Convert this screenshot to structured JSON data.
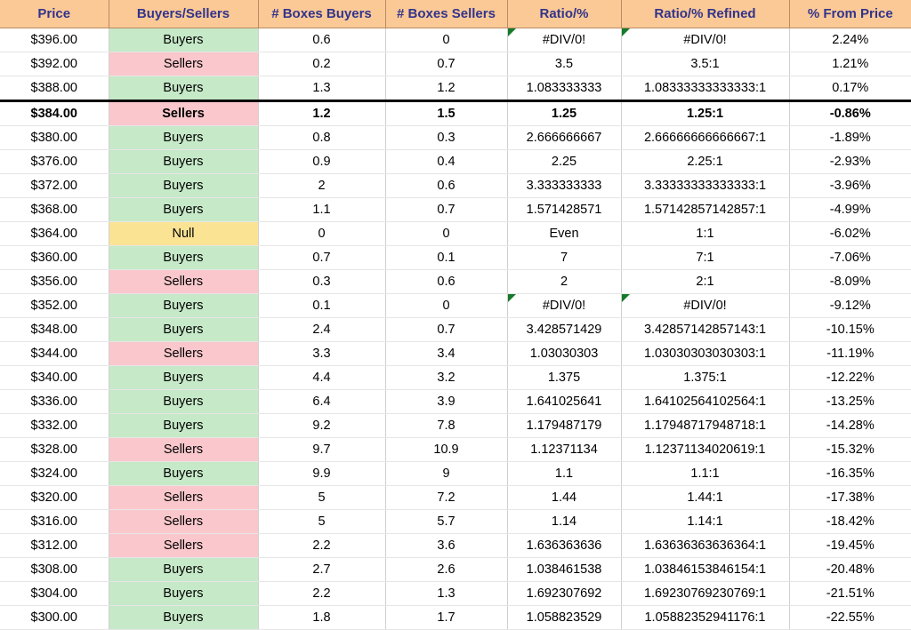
{
  "table": {
    "columns": [
      {
        "key": "price",
        "label": "Price"
      },
      {
        "key": "side",
        "label": "Buyers/Sellers"
      },
      {
        "key": "boxes_buy",
        "label": "# Boxes Buyers"
      },
      {
        "key": "boxes_sell",
        "label": "# Boxes Sellers"
      },
      {
        "key": "ratio",
        "label": "Ratio/%"
      },
      {
        "key": "ratio_ref",
        "label": "Ratio/% Refined"
      },
      {
        "key": "pct",
        "label": "% From Price"
      }
    ],
    "colors": {
      "header_bg": "#FBC996",
      "header_text": "#32348C",
      "buyers_bg": "#C6E9C8",
      "buyers_text": "#1F7A1F",
      "sellers_bg": "#FAC7CC",
      "sellers_text": "#D81633",
      "null_bg": "#FBE394",
      "null_text": "#D98A18",
      "error_marker": "#167A2B",
      "focus_border": "#000000"
    },
    "rows": [
      {
        "price": "$396.00",
        "side": "Buyers",
        "side_fill": "buyers",
        "boxes_buy": "0.6",
        "boxes_sell": "0",
        "ratio": "#DIV/0!",
        "ratio_error": true,
        "ratio_ref": "#DIV/0!",
        "ratio_ref_error": true,
        "pct": "2.24%",
        "focus": false
      },
      {
        "price": "$392.00",
        "side": "Sellers",
        "side_fill": "sellers",
        "boxes_buy": "0.2",
        "boxes_sell": "0.7",
        "ratio": "3.5",
        "ratio_error": false,
        "ratio_ref": "3.5:1",
        "ratio_ref_error": false,
        "pct": "1.21%",
        "focus": false
      },
      {
        "price": "$388.00",
        "side": "Buyers",
        "side_fill": "buyers",
        "boxes_buy": "1.3",
        "boxes_sell": "1.2",
        "ratio": "1.083333333",
        "ratio_error": false,
        "ratio_ref": "1.08333333333333:1",
        "ratio_ref_error": false,
        "pct": "0.17%",
        "focus": false
      },
      {
        "price": "$384.00",
        "side": "Sellers",
        "side_fill": "sellers",
        "boxes_buy": "1.2",
        "boxes_sell": "1.5",
        "ratio": "1.25",
        "ratio_error": false,
        "ratio_ref": "1.25:1",
        "ratio_ref_error": false,
        "pct": "-0.86%",
        "focus": true
      },
      {
        "price": "$380.00",
        "side": "Buyers",
        "side_fill": "buyers",
        "boxes_buy": "0.8",
        "boxes_sell": "0.3",
        "ratio": "2.666666667",
        "ratio_error": false,
        "ratio_ref": "2.66666666666667:1",
        "ratio_ref_error": false,
        "pct": "-1.89%",
        "focus": false
      },
      {
        "price": "$376.00",
        "side": "Buyers",
        "side_fill": "buyers",
        "boxes_buy": "0.9",
        "boxes_sell": "0.4",
        "ratio": "2.25",
        "ratio_error": false,
        "ratio_ref": "2.25:1",
        "ratio_ref_error": false,
        "pct": "-2.93%",
        "focus": false
      },
      {
        "price": "$372.00",
        "side": "Buyers",
        "side_fill": "buyers",
        "boxes_buy": "2",
        "boxes_sell": "0.6",
        "ratio": "3.333333333",
        "ratio_error": false,
        "ratio_ref": "3.33333333333333:1",
        "ratio_ref_error": false,
        "pct": "-3.96%",
        "focus": false
      },
      {
        "price": "$368.00",
        "side": "Buyers",
        "side_fill": "buyers",
        "boxes_buy": "1.1",
        "boxes_sell": "0.7",
        "ratio": "1.571428571",
        "ratio_error": false,
        "ratio_ref": "1.57142857142857:1",
        "ratio_ref_error": false,
        "pct": "-4.99%",
        "focus": false
      },
      {
        "price": "$364.00",
        "side": "Null",
        "side_fill": "null",
        "boxes_buy": "0",
        "boxes_sell": "0",
        "ratio": "Even",
        "ratio_error": false,
        "ratio_ref": "1:1",
        "ratio_ref_error": false,
        "pct": "-6.02%",
        "focus": false
      },
      {
        "price": "$360.00",
        "side": "Buyers",
        "side_fill": "buyers",
        "boxes_buy": "0.7",
        "boxes_sell": "0.1",
        "ratio": "7",
        "ratio_error": false,
        "ratio_ref": "7:1",
        "ratio_ref_error": false,
        "pct": "-7.06%",
        "focus": false
      },
      {
        "price": "$356.00",
        "side": "Sellers",
        "side_fill": "sellers",
        "boxes_buy": "0.3",
        "boxes_sell": "0.6",
        "ratio": "2",
        "ratio_error": false,
        "ratio_ref": "2:1",
        "ratio_ref_error": false,
        "pct": "-8.09%",
        "focus": false
      },
      {
        "price": "$352.00",
        "side": "Buyers",
        "side_fill": "buyers",
        "boxes_buy": "0.1",
        "boxes_sell": "0",
        "ratio": "#DIV/0!",
        "ratio_error": true,
        "ratio_ref": "#DIV/0!",
        "ratio_ref_error": true,
        "pct": "-9.12%",
        "focus": false
      },
      {
        "price": "$348.00",
        "side": "Buyers",
        "side_fill": "buyers",
        "boxes_buy": "2.4",
        "boxes_sell": "0.7",
        "ratio": "3.428571429",
        "ratio_error": false,
        "ratio_ref": "3.42857142857143:1",
        "ratio_ref_error": false,
        "pct": "-10.15%",
        "focus": false
      },
      {
        "price": "$344.00",
        "side": "Sellers",
        "side_fill": "sellers",
        "boxes_buy": "3.3",
        "boxes_sell": "3.4",
        "ratio": "1.03030303",
        "ratio_error": false,
        "ratio_ref": "1.03030303030303:1",
        "ratio_ref_error": false,
        "pct": "-11.19%",
        "focus": false
      },
      {
        "price": "$340.00",
        "side": "Buyers",
        "side_fill": "buyers",
        "boxes_buy": "4.4",
        "boxes_sell": "3.2",
        "ratio": "1.375",
        "ratio_error": false,
        "ratio_ref": "1.375:1",
        "ratio_ref_error": false,
        "pct": "-12.22%",
        "focus": false
      },
      {
        "price": "$336.00",
        "side": "Buyers",
        "side_fill": "buyers",
        "boxes_buy": "6.4",
        "boxes_sell": "3.9",
        "ratio": "1.641025641",
        "ratio_error": false,
        "ratio_ref": "1.64102564102564:1",
        "ratio_ref_error": false,
        "pct": "-13.25%",
        "focus": false
      },
      {
        "price": "$332.00",
        "side": "Buyers",
        "side_fill": "buyers",
        "boxes_buy": "9.2",
        "boxes_sell": "7.8",
        "ratio": "1.179487179",
        "ratio_error": false,
        "ratio_ref": "1.17948717948718:1",
        "ratio_ref_error": false,
        "pct": "-14.28%",
        "focus": false
      },
      {
        "price": "$328.00",
        "side": "Sellers",
        "side_fill": "sellers",
        "boxes_buy": "9.7",
        "boxes_sell": "10.9",
        "ratio": "1.12371134",
        "ratio_error": false,
        "ratio_ref": "1.12371134020619:1",
        "ratio_ref_error": false,
        "pct": "-15.32%",
        "focus": false
      },
      {
        "price": "$324.00",
        "side": "Buyers",
        "side_fill": "buyers",
        "boxes_buy": "9.9",
        "boxes_sell": "9",
        "ratio": "1.1",
        "ratio_error": false,
        "ratio_ref": "1.1:1",
        "ratio_ref_error": false,
        "pct": "-16.35%",
        "focus": false
      },
      {
        "price": "$320.00",
        "side": "Sellers",
        "side_fill": "sellers",
        "boxes_buy": "5",
        "boxes_sell": "7.2",
        "ratio": "1.44",
        "ratio_error": false,
        "ratio_ref": "1.44:1",
        "ratio_ref_error": false,
        "pct": "-17.38%",
        "focus": false
      },
      {
        "price": "$316.00",
        "side": "Sellers",
        "side_fill": "sellers",
        "boxes_buy": "5",
        "boxes_sell": "5.7",
        "ratio": "1.14",
        "ratio_error": false,
        "ratio_ref": "1.14:1",
        "ratio_ref_error": false,
        "pct": "-18.42%",
        "focus": false
      },
      {
        "price": "$312.00",
        "side": "Sellers",
        "side_fill": "sellers",
        "boxes_buy": "2.2",
        "boxes_sell": "3.6",
        "ratio": "1.636363636",
        "ratio_error": false,
        "ratio_ref": "1.63636363636364:1",
        "ratio_ref_error": false,
        "pct": "-19.45%",
        "focus": false
      },
      {
        "price": "$308.00",
        "side": "Buyers",
        "side_fill": "buyers",
        "boxes_buy": "2.7",
        "boxes_sell": "2.6",
        "ratio": "1.038461538",
        "ratio_error": false,
        "ratio_ref": "1.03846153846154:1",
        "ratio_ref_error": false,
        "pct": "-20.48%",
        "focus": false
      },
      {
        "price": "$304.00",
        "side": "Buyers",
        "side_fill": "buyers",
        "boxes_buy": "2.2",
        "boxes_sell": "1.3",
        "ratio": "1.692307692",
        "ratio_error": false,
        "ratio_ref": "1.69230769230769:1",
        "ratio_ref_error": false,
        "pct": "-21.51%",
        "focus": false
      },
      {
        "price": "$300.00",
        "side": "Buyers",
        "side_fill": "buyers",
        "boxes_buy": "1.8",
        "boxes_sell": "1.7",
        "ratio": "1.058823529",
        "ratio_error": false,
        "ratio_ref": "1.05882352941176:1",
        "ratio_ref_error": false,
        "pct": "-22.55%",
        "focus": false
      }
    ]
  }
}
